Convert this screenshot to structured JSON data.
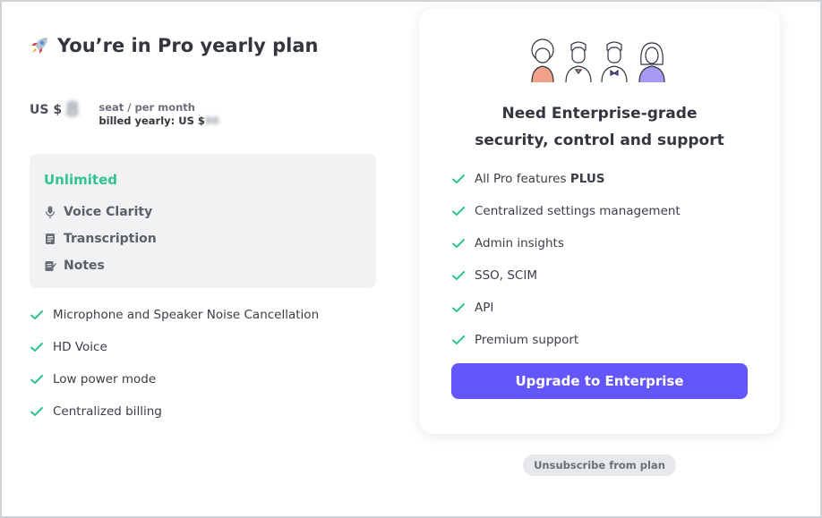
{
  "plan": {
    "title": "You’re in Pro yearly plan",
    "currency": "US $",
    "price_blurred": "8",
    "seat_label": "seat / per month",
    "billed_label": "billed yearly: US $",
    "billed_value_blurred": "96"
  },
  "unlimited": {
    "title": "Unlimited",
    "items": [
      {
        "icon": "microphone-icon",
        "label": "Voice Clarity"
      },
      {
        "icon": "document-icon",
        "label": "Transcription"
      },
      {
        "icon": "notes-icon",
        "label": "Notes"
      }
    ]
  },
  "pro_features": [
    "Microphone and Speaker Noise Cancellation",
    "HD Voice",
    "Low power mode",
    "Centralized billing"
  ],
  "enterprise": {
    "title_line1": "Need Enterprise-grade",
    "title_line2": "security, control and support",
    "features": [
      {
        "text": "All Pro features ",
        "bold": "PLUS"
      },
      {
        "text": "Centralized settings management",
        "bold": ""
      },
      {
        "text": "Admin insights",
        "bold": ""
      },
      {
        "text": "SSO, SCIM",
        "bold": ""
      },
      {
        "text": "API",
        "bold": ""
      },
      {
        "text": "Premium support",
        "bold": ""
      }
    ],
    "upgrade_label": "Upgrade to Enterprise"
  },
  "unsubscribe_label": "Unsubscribe from plan",
  "colors": {
    "accent_green": "#31c48d",
    "button_purple": "#6356fa",
    "panel_gray": "#f1f2f4"
  }
}
